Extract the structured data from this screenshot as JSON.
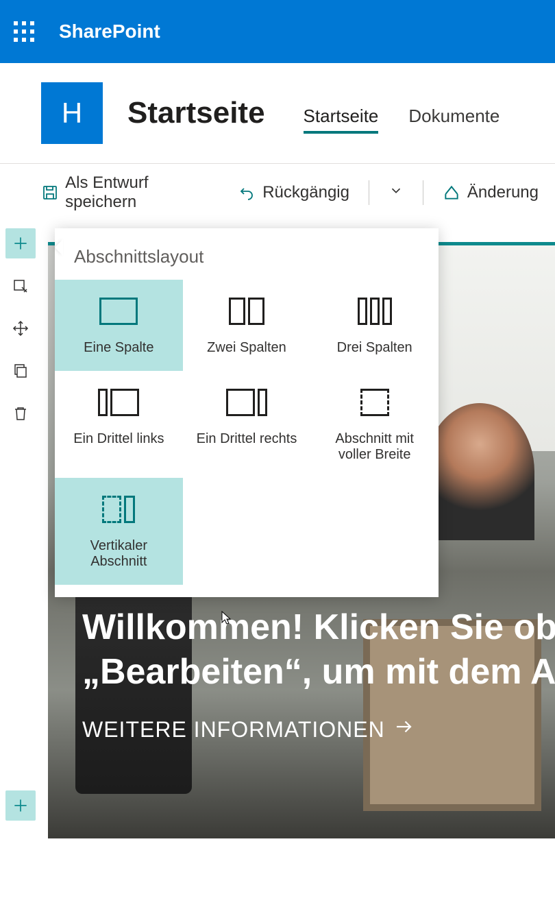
{
  "topbar": {
    "brand": "SharePoint"
  },
  "site": {
    "logo_letter": "H",
    "title": "Startseite",
    "tabs": [
      {
        "label": "Startseite",
        "active": true
      },
      {
        "label": "Dokumente",
        "active": false
      }
    ]
  },
  "cmdbar": {
    "save_draft": "Als Entwurf speichern",
    "undo": "Rückgängig",
    "changes": "Änderung"
  },
  "hero": {
    "title_line1": "Willkommen! Klicken Sie ob",
    "title_line2": "„Bearbeiten“, um mit dem A",
    "cta": "WEITERE INFORMATIONEN"
  },
  "popover": {
    "title": "Abschnittslayout",
    "options": [
      {
        "label": "Eine Spalte"
      },
      {
        "label": "Zwei Spalten"
      },
      {
        "label": "Drei Spalten"
      },
      {
        "label": "Ein Drittel links"
      },
      {
        "label": "Ein Drittel rechts"
      },
      {
        "label": "Abschnitt mit voller Breite"
      },
      {
        "label": "Vertikaler Abschnitt"
      }
    ]
  }
}
